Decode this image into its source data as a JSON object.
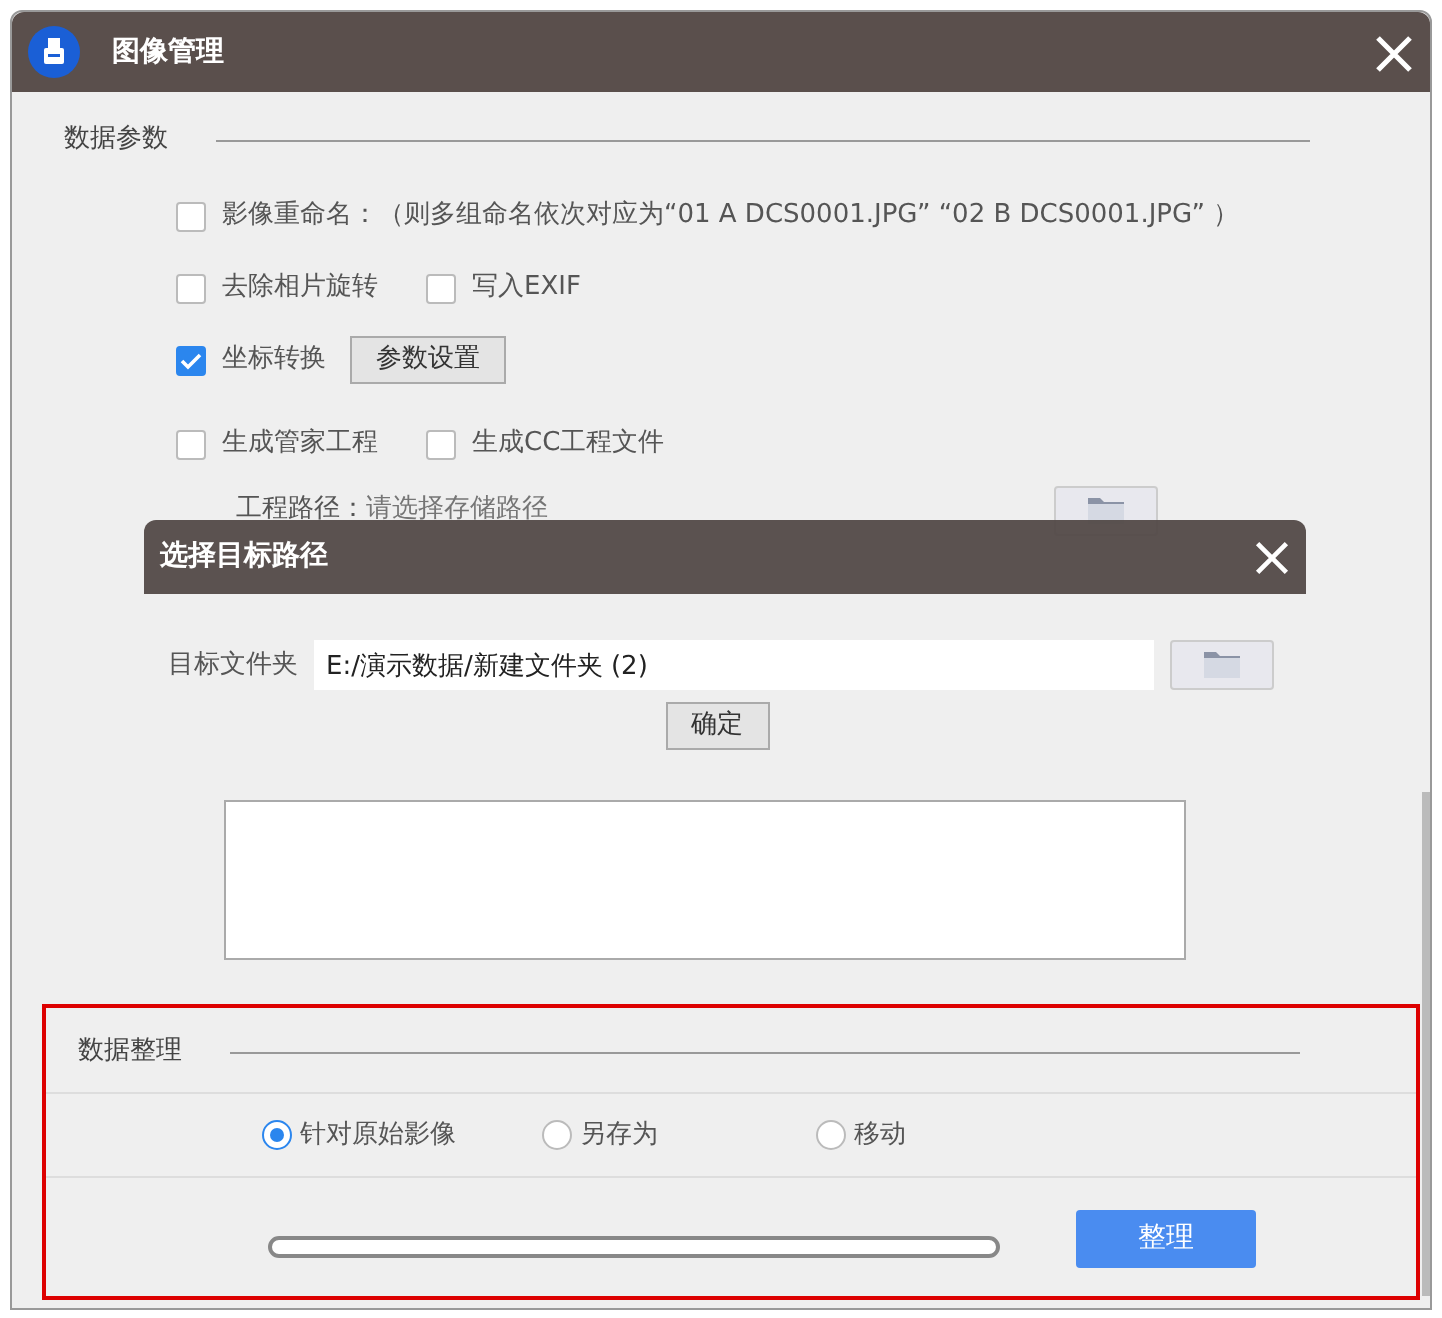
{
  "window": {
    "title": "图像管理"
  },
  "data_params": {
    "heading": "数据参数",
    "option_rows": [
      [
        {
          "kind": "checkbox",
          "label": "影像重命名：（则多组命名依次对应为“01  A  DCS0001.JPG”  “02  B  DCS0001.JPG”  ）",
          "checked": false
        }
      ],
      [
        {
          "kind": "checkbox",
          "label": "去除相片旋转",
          "checked": false
        },
        {
          "kind": "checkbox",
          "label": "写入EXIF",
          "checked": false
        }
      ],
      [
        {
          "kind": "checkbox",
          "label": "坐标转换",
          "checked": true
        },
        {
          "kind": "button",
          "label": "参数设置"
        }
      ],
      [
        {
          "kind": "checkbox",
          "label": "生成管家工程",
          "checked": false
        },
        {
          "kind": "checkbox",
          "label": "生成CC工程文件",
          "checked": false
        }
      ]
    ],
    "project_path": {
      "label": "工程路径：",
      "placeholder": "请选择存储路径"
    }
  },
  "dialog": {
    "title": "选择目标路径",
    "field_label": "目标文件夹",
    "field_value": "E:/演示数据/新建文件夹 (2)",
    "confirm": "确定"
  },
  "organize": {
    "heading": "数据整理",
    "radios": [
      {
        "label": "针对原始影像",
        "selected": true
      },
      {
        "label": "另存为",
        "selected": false
      },
      {
        "label": "移动",
        "selected": false
      }
    ],
    "progress": {
      "level": 0
    },
    "button": "整理"
  }
}
